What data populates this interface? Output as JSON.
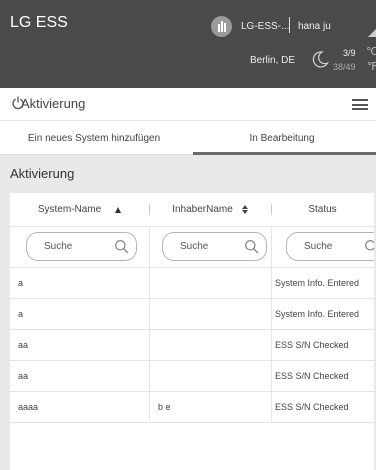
{
  "header": {
    "brand": "LG ESS",
    "system_name": "LG-ESS-...",
    "user_name": "hana ju",
    "location": "Berlin, DE",
    "temp_celsius": "3/9",
    "temp_fahrenheit": "38/49",
    "unit_c": "℃",
    "unit_f": "℉",
    "system_icon": "building-icon",
    "weather_icon": "moon-icon"
  },
  "titlebar": {
    "title": "Aktivierung",
    "icon": "power-icon",
    "menu_icon": "hamburger-menu-icon"
  },
  "tabs": [
    {
      "label": "Ein neues System hinzufügen",
      "active": false
    },
    {
      "label": "In Bearbeitung",
      "active": true
    }
  ],
  "section": {
    "title": "Aktivierung"
  },
  "table": {
    "columns": [
      {
        "label": "System-Name",
        "sort": "ascending"
      },
      {
        "label": "InhaberName",
        "sort": "unsorted"
      },
      {
        "label": "Status",
        "sort": "none"
      }
    ],
    "search_placeholder": "Suche",
    "rows": [
      [
        "a",
        "",
        "System Info. Entered"
      ],
      [
        "a",
        "",
        "System Info. Entered"
      ],
      [
        "aa",
        "",
        "ESS S/N Checked"
      ],
      [
        "aa",
        "",
        "ESS S/N Checked"
      ],
      [
        "aaaa",
        "b e",
        "ESS S/N Checked"
      ]
    ]
  },
  "colors": {
    "header_bg": "#4a4a4a",
    "page_bg": "#e9e9e9",
    "active_tab_indicator": "#6b6b6b"
  }
}
